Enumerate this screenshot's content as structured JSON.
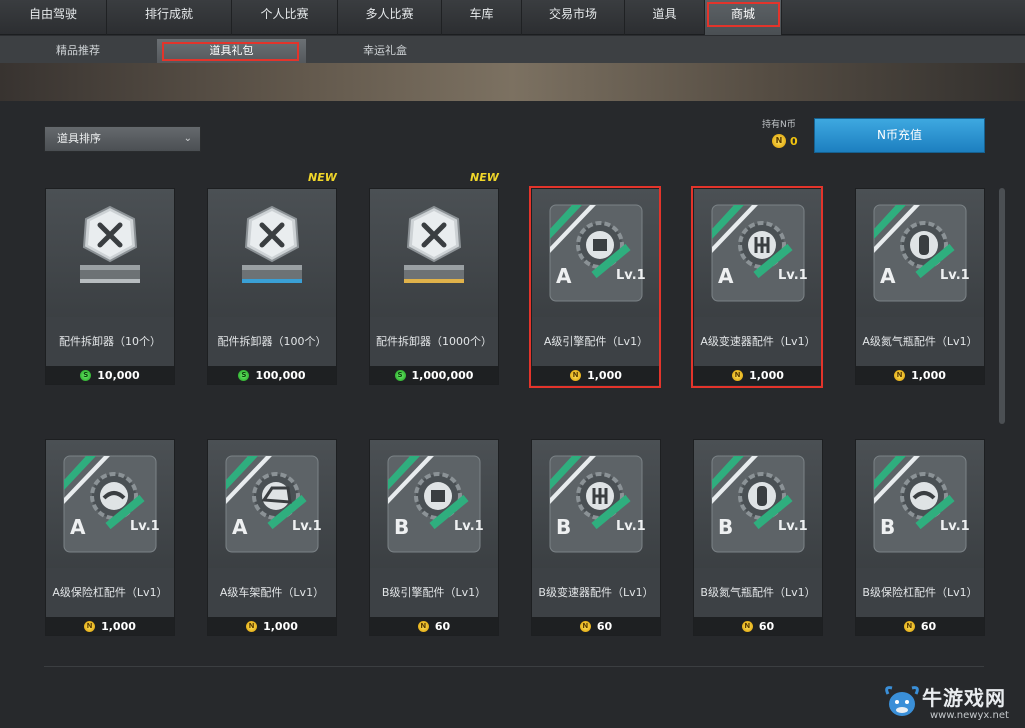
{
  "top_tabs": [
    {
      "label": "自由驾驶",
      "active": false
    },
    {
      "label": "排行成就",
      "active": false
    },
    {
      "label": "个人比赛",
      "active": false
    },
    {
      "label": "多人比赛",
      "active": false
    },
    {
      "label": "车库",
      "active": false
    },
    {
      "label": "交易市场",
      "active": false
    },
    {
      "label": "道具",
      "active": false
    },
    {
      "label": "商城",
      "active": true
    }
  ],
  "sub_tabs": [
    {
      "label": "精品推荐",
      "active": false
    },
    {
      "label": "道具礼包",
      "active": true
    },
    {
      "label": "幸运礼盒",
      "active": false
    }
  ],
  "toolbar": {
    "sort_label": "道具排序",
    "coins_label": "持有N币",
    "coins_value": "0",
    "recharge_label": "N币充值"
  },
  "items": [
    {
      "name": "配件拆卸器（10个）",
      "price": "10,000",
      "currency": "S",
      "icon": "tool-box-icon",
      "tier": "silver",
      "is_new": false
    },
    {
      "name": "配件拆卸器（100个）",
      "price": "100,000",
      "currency": "S",
      "icon": "tool-box-icon",
      "tier": "blue",
      "is_new": true
    },
    {
      "name": "配件拆卸器（1000个）",
      "price": "1,000,000",
      "currency": "S",
      "icon": "tool-box-icon",
      "tier": "gold",
      "is_new": true
    },
    {
      "name": "A级引擎配件（Lv1）",
      "price": "1,000",
      "currency": "N",
      "icon": "engine-icon",
      "grade": "A",
      "level": "Lv.1"
    },
    {
      "name": "A级变速器配件（Lv1）",
      "price": "1,000",
      "currency": "N",
      "icon": "gearbox-icon",
      "grade": "A",
      "level": "Lv.1"
    },
    {
      "name": "A级氮气瓶配件（Lv1）",
      "price": "1,000",
      "currency": "N",
      "icon": "nitro-icon",
      "grade": "A",
      "level": "Lv.1"
    },
    {
      "name": "A级保险杠配件（Lv1）",
      "price": "1,000",
      "currency": "N",
      "icon": "bumper-icon",
      "grade": "A",
      "level": "Lv.1"
    },
    {
      "name": "A级车架配件（Lv1）",
      "price": "1,000",
      "currency": "N",
      "icon": "chassis-icon",
      "grade": "A",
      "level": "Lv.1"
    },
    {
      "name": "B级引擎配件（Lv1）",
      "price": "60",
      "currency": "N",
      "icon": "engine-icon",
      "grade": "B",
      "level": "Lv.1"
    },
    {
      "name": "B级变速器配件（Lv1）",
      "price": "60",
      "currency": "N",
      "icon": "gearbox-icon",
      "grade": "B",
      "level": "Lv.1"
    },
    {
      "name": "B级氮气瓶配件（Lv1）",
      "price": "60",
      "currency": "N",
      "icon": "nitro-icon",
      "grade": "B",
      "level": "Lv.1"
    },
    {
      "name": "B级保险杠配件（Lv1）",
      "price": "60",
      "currency": "N",
      "icon": "bumper-icon",
      "grade": "B",
      "level": "Lv.1"
    }
  ],
  "new_tag": "NEW",
  "watermark": {
    "text": "牛游戏网",
    "url": "www.newyx.net"
  },
  "colors": {
    "highlight": "#e3342b",
    "accent": "#2a8fd0",
    "gold": "#f2c40f"
  }
}
